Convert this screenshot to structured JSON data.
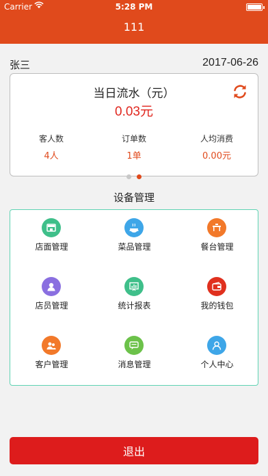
{
  "status_bar": {
    "carrier": "Carrier",
    "time": "5:28 PM"
  },
  "nav": {
    "title": "111"
  },
  "user": {
    "name": "张三",
    "date": "2017-06-26"
  },
  "summary": {
    "title": "当日流水（元）",
    "amount": "0.03元",
    "stats": [
      {
        "label": "客人数",
        "value": "4人"
      },
      {
        "label": "订单数",
        "value": "1单"
      },
      {
        "label": "人均消费",
        "value": "0.00元"
      }
    ],
    "page_count": 2,
    "active_page": 2
  },
  "devices": {
    "title": "设备管理",
    "items": [
      {
        "label": "店面管理",
        "icon": "storefront-icon",
        "color": "#3fbf8a"
      },
      {
        "label": "菜品管理",
        "icon": "dish-icon",
        "color": "#3ea6e8"
      },
      {
        "label": "餐台管理",
        "icon": "table-icon",
        "color": "#f2792a"
      },
      {
        "label": "店员管理",
        "icon": "staff-icon",
        "color": "#8a6fe0"
      },
      {
        "label": "统计报表",
        "icon": "report-icon",
        "color": "#3fbf8a"
      },
      {
        "label": "我的钱包",
        "icon": "wallet-icon",
        "color": "#e0301e"
      },
      {
        "label": "客户管理",
        "icon": "customers-icon",
        "color": "#f2792a"
      },
      {
        "label": "消息管理",
        "icon": "message-icon",
        "color": "#6cc24a"
      },
      {
        "label": "个人中心",
        "icon": "profile-icon",
        "color": "#3ea6e8"
      }
    ]
  },
  "logout": {
    "label": "退出"
  },
  "colors": {
    "header": "#e04a1c",
    "accent": "#e0261e",
    "panel_border": "#5ed3b2",
    "logout": "#dd1c1c"
  }
}
